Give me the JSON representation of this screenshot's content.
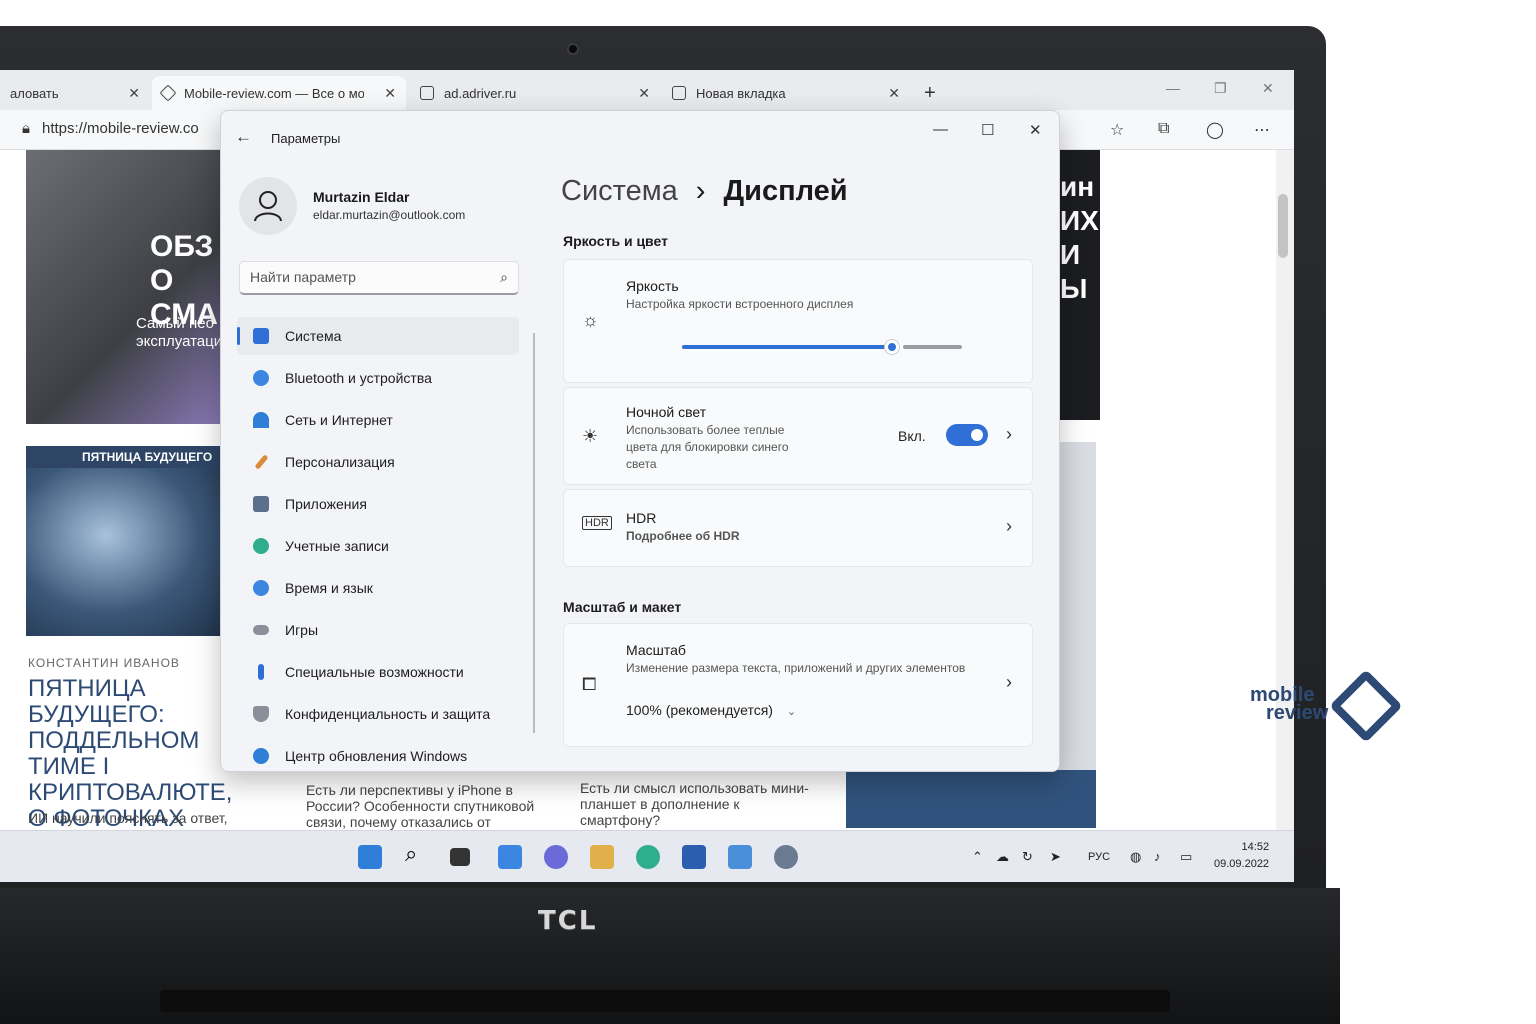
{
  "browser": {
    "tabs": [
      {
        "label": "аловать"
      },
      {
        "label": "Mobile-review.com — Все о мо"
      },
      {
        "label": "ad.adriver.ru"
      },
      {
        "label": "Новая вкладка"
      }
    ],
    "new_tab_label": "+",
    "url": "https://mobile-review.co"
  },
  "webpage": {
    "hero_title": "ОБЗ О СМА",
    "hero_sub": "Самый нео эксплуатаци",
    "promo_label": "ПЯТНИЦА БУДУЩЕГО",
    "author": "КОНСТАНТИН ИВАНОВ",
    "headline": "ПЯТНИЦА БУДУЩЕГО: ПОДДЕЛЬНОМ ТИМЕ I КРИПТОВАЛЮТЕ, О ФОТОЧКАХ КОТИКО ОНЛАЙН-ДИАГНОЗАХ",
    "snippet1": "ИИ научили пояснять за ответ,",
    "snippet2": "Есть ли перспективы у iPhone в России? Особенности спутниковой связи, почему отказались от",
    "snippet3": "Есть ли смысл использовать мини-планшет в дополнение к смартфону?",
    "right_ad": "ин ИХ И Ы"
  },
  "settings": {
    "title": "Параметры",
    "user": {
      "name": "Murtazin Eldar",
      "email": "eldar.murtazin@outlook.com"
    },
    "search_placeholder": "Найти параметр",
    "nav": [
      {
        "label": "Система",
        "color": "#2f6fd6"
      },
      {
        "label": "Bluetooth и устройства",
        "color": "#3a86e0"
      },
      {
        "label": "Сеть и Интернет",
        "color": "#2f7ed8"
      },
      {
        "label": "Персонализация",
        "color": "#d98b3a"
      },
      {
        "label": "Приложения",
        "color": "#5b6f8a"
      },
      {
        "label": "Учетные записи",
        "color": "#2fae8e"
      },
      {
        "label": "Время и язык",
        "color": "#3a86e0"
      },
      {
        "label": "Игры",
        "color": "#8a8f99"
      },
      {
        "label": "Специальные возможности",
        "color": "#2f6fd6"
      },
      {
        "label": "Конфиденциальность и защита",
        "color": "#8a8f99"
      },
      {
        "label": "Центр обновления Windows",
        "color": "#2f7ed8"
      }
    ],
    "breadcrumb": {
      "parent": "Система",
      "sep": "›",
      "current": "Дисплей"
    },
    "section_brightness": "Яркость и цвет",
    "brightness": {
      "title": "Яркость",
      "desc": "Настройка яркости встроенного дисплея",
      "level": 0.75
    },
    "night_light": {
      "title": "Ночной свет",
      "desc": "Использовать более теплые цвета для блокировки синего света",
      "state": "Вкл."
    },
    "hdr": {
      "title": "HDR",
      "link": "Подробнее об HDR"
    },
    "section_scale": "Масштаб и макет",
    "scale": {
      "title": "Масштаб",
      "desc": "Изменение размера текста, приложений и других элементов",
      "value": "100% (рекомендуется)"
    }
  },
  "taskbar": {
    "lang": "РУС",
    "time": "14:52",
    "date": "09.09.2022"
  },
  "laptop": {
    "brand": "TCL"
  },
  "watermark": {
    "line1": "mobile",
    "line2": "review"
  },
  "colors": {
    "accent": "#2f6fd6",
    "brand": "#2d4a75"
  }
}
